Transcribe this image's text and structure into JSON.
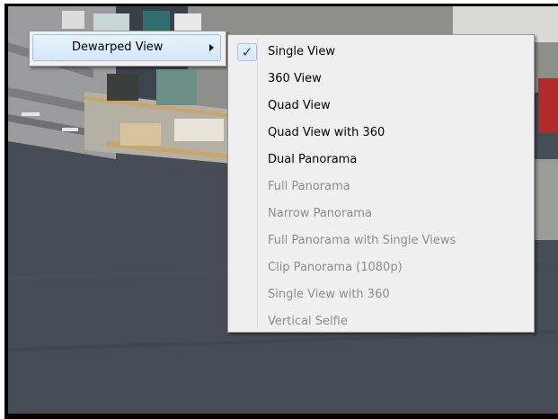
{
  "context_menu": {
    "item": {
      "label": "Dewarped View"
    }
  },
  "submenu": {
    "check_glyph": "✓",
    "items": [
      {
        "label": "Single View",
        "enabled": true,
        "checked": true
      },
      {
        "label": "360 View",
        "enabled": true,
        "checked": false
      },
      {
        "label": "Quad View",
        "enabled": true,
        "checked": false
      },
      {
        "label": "Quad View with 360",
        "enabled": true,
        "checked": false
      },
      {
        "label": "Dual Panorama",
        "enabled": true,
        "checked": false
      },
      {
        "label": "Full Panorama",
        "enabled": false,
        "checked": false
      },
      {
        "label": "Narrow Panorama",
        "enabled": false,
        "checked": false
      },
      {
        "label": "Full Panorama with Single Views",
        "enabled": false,
        "checked": false
      },
      {
        "label": "Clip Panorama (1080p)",
        "enabled": false,
        "checked": false
      },
      {
        "label": "Single View with 360",
        "enabled": false,
        "checked": false
      },
      {
        "label": "Vertical Selfie",
        "enabled": false,
        "checked": false
      }
    ]
  }
}
